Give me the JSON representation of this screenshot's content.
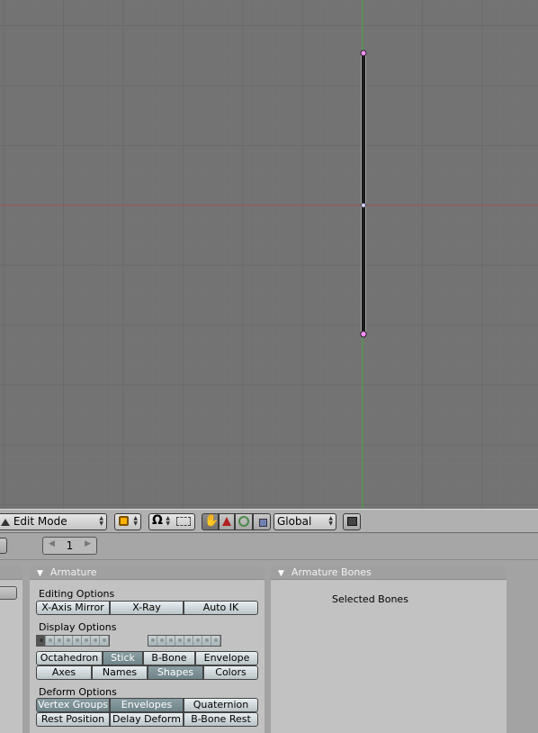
{
  "viewport": {
    "grid_color": "#6b6b6b",
    "bg_color": "#737373",
    "x_axis_color": "#a05050",
    "y_axis_color": "#3fae3f",
    "bone": {
      "fill": "#1a1a1a",
      "joint_color": "#ff90ff"
    }
  },
  "header": {
    "mode_label": "Edit Mode",
    "pivot_icon": "pivot-icon",
    "snap_icon": "magnet-icon",
    "transform_space": "Global",
    "render_icon": "render-icon"
  },
  "subbar": {
    "frame_value": "1"
  },
  "armature_panel": {
    "title": "Armature",
    "editing_options_label": "Editing Options",
    "editing_buttons": [
      {
        "label": "X-Axis Mirror",
        "active": false
      },
      {
        "label": "X-Ray",
        "active": false
      },
      {
        "label": "Auto IK",
        "active": false
      }
    ],
    "display_options_label": "Display Options",
    "display_buttons_row1": [
      {
        "label": "Octahedron",
        "active": false
      },
      {
        "label": "Stick",
        "active": true
      },
      {
        "label": "B-Bone",
        "active": false
      },
      {
        "label": "Envelope",
        "active": false
      }
    ],
    "display_buttons_row2": [
      {
        "label": "Axes",
        "active": false
      },
      {
        "label": "Names",
        "active": false
      },
      {
        "label": "Shapes",
        "active": true
      },
      {
        "label": "Colors",
        "active": false
      }
    ],
    "deform_options_label": "Deform Options",
    "deform_buttons_row1": [
      {
        "label": "Vertex Groups",
        "active": true
      },
      {
        "label": "Envelopes",
        "active": true
      },
      {
        "label": "Quaternion",
        "active": false
      }
    ],
    "deform_buttons_row2": [
      {
        "label": "Rest Position",
        "active": false
      },
      {
        "label": "Delay Deform",
        "active": false
      },
      {
        "label": "B-Bone Rest",
        "active": false
      }
    ]
  },
  "bones_panel": {
    "title": "Armature Bones",
    "selected_label": "Selected Bones"
  }
}
